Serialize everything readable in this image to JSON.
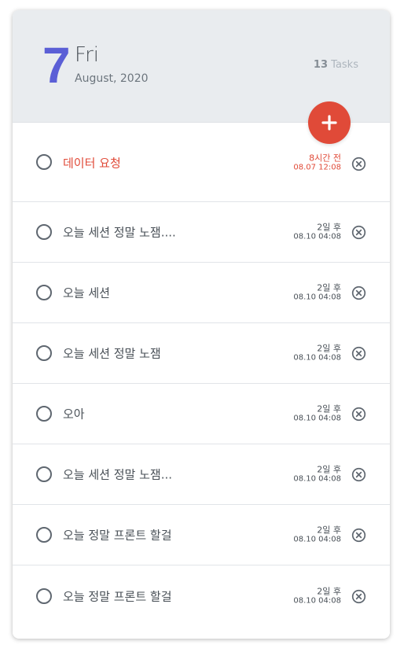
{
  "header": {
    "day": "7",
    "weekday": "Fri",
    "month_year": "August, 2020",
    "task_count": "13",
    "task_label": "Tasks"
  },
  "colors": {
    "accent": "#5b5fd6",
    "add_button": "#e04a38",
    "urgent": "#e04a38"
  },
  "icons": {
    "add": "plus-icon",
    "delete": "close-circle-icon",
    "check": "circle-outline-icon"
  },
  "items": [
    {
      "text": "데이터 요청",
      "relative": "8시간 전",
      "absolute": "08.07 12:08",
      "urgent": true
    },
    {
      "text": "오늘 세션 정말 노잼....",
      "relative": "2일 후",
      "absolute": "08.10 04:08",
      "urgent": false
    },
    {
      "text": "오늘 세션",
      "relative": "2일 후",
      "absolute": "08.10 04:08",
      "urgent": false
    },
    {
      "text": "오늘 세션 정말 노잼",
      "relative": "2일 후",
      "absolute": "08.10 04:08",
      "urgent": false
    },
    {
      "text": "오아",
      "relative": "2일 후",
      "absolute": "08.10 04:08",
      "urgent": false
    },
    {
      "text": "오늘 세션 정말 노잼...",
      "relative": "2일 후",
      "absolute": "08.10 04:08",
      "urgent": false
    },
    {
      "text": "오늘 정말 프론트 할걸",
      "relative": "2일 후",
      "absolute": "08.10 04:08",
      "urgent": false
    },
    {
      "text": "오늘 정말 프론트 할걸",
      "relative": "2일 후",
      "absolute": "08.10 04:08",
      "urgent": false
    }
  ]
}
